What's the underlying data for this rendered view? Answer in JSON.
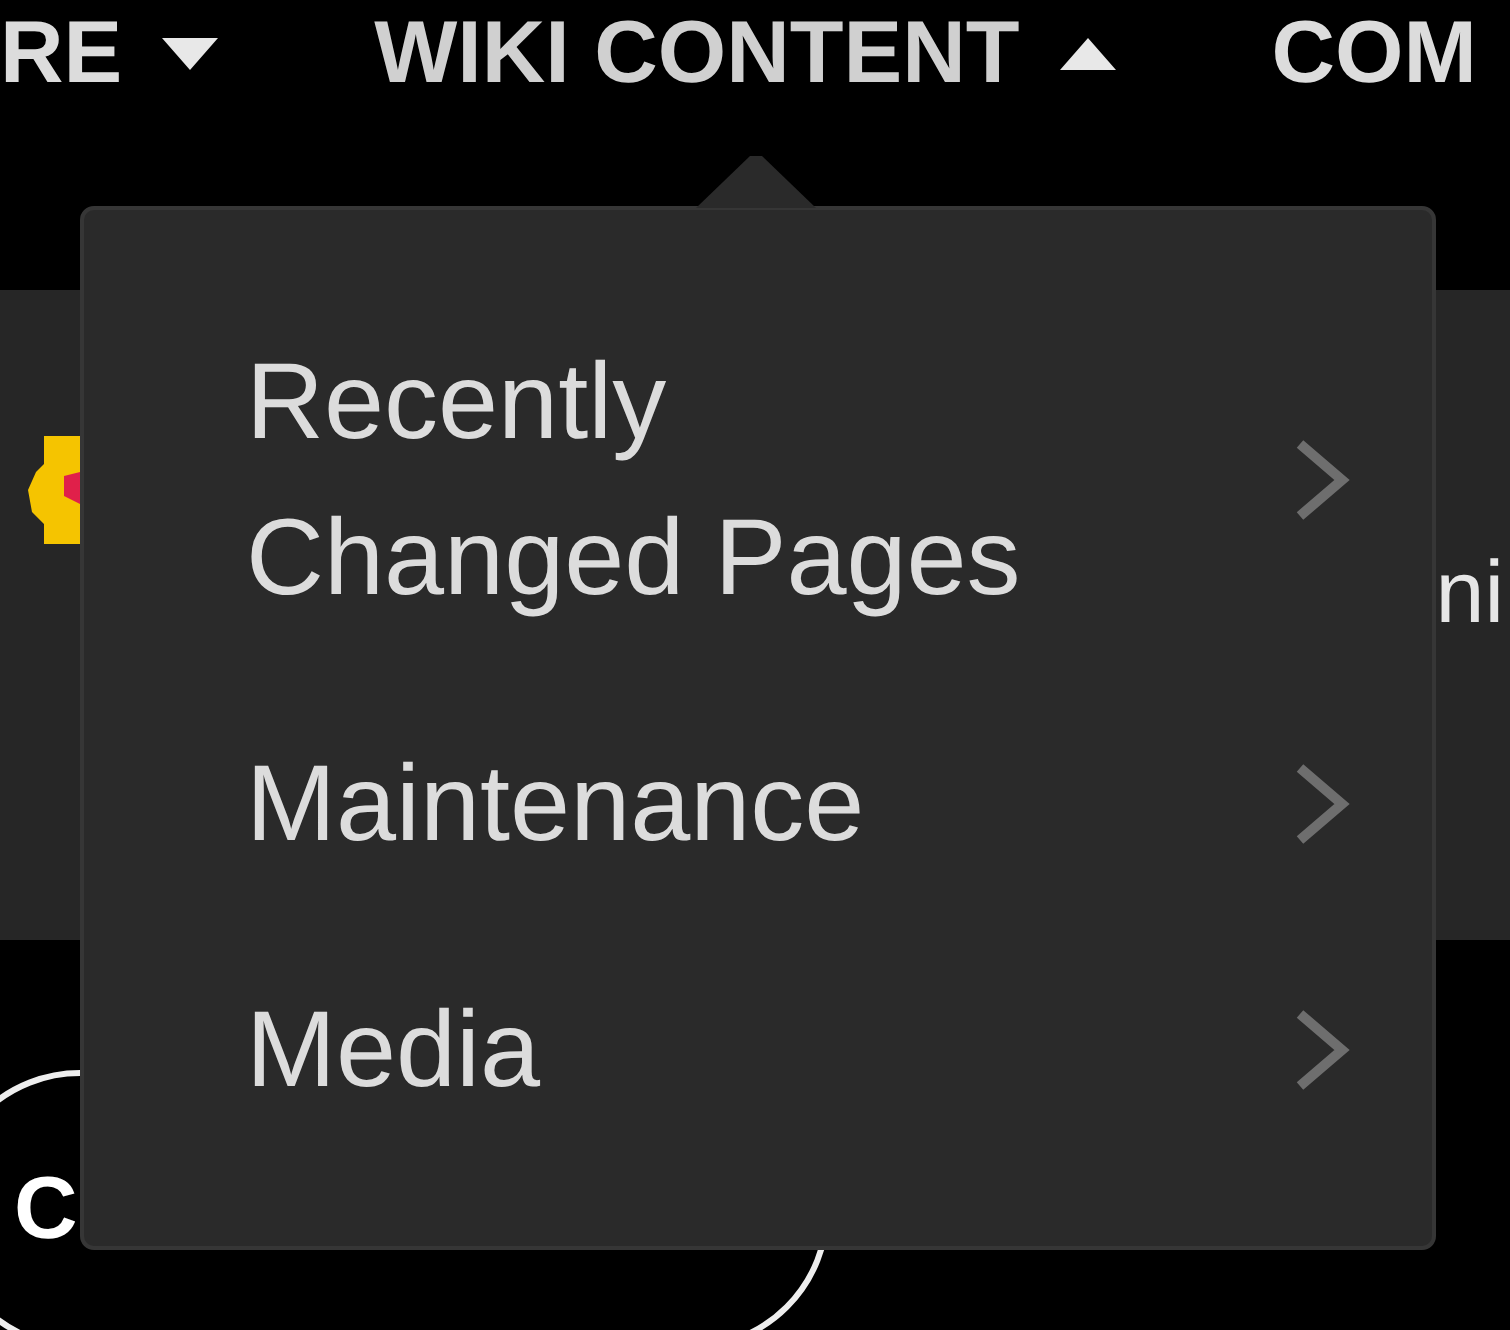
{
  "nav": {
    "items": [
      {
        "label": "RE",
        "expanded": false
      },
      {
        "label": "WIKI CONTENT",
        "expanded": true
      },
      {
        "label": "COM"
      }
    ]
  },
  "band": {
    "text": "ni"
  },
  "lower": {
    "button_label": "C"
  },
  "menu": {
    "items": [
      {
        "label": "Recently Changed Pages"
      },
      {
        "label": "Maintenance"
      },
      {
        "label": "Media"
      }
    ]
  }
}
